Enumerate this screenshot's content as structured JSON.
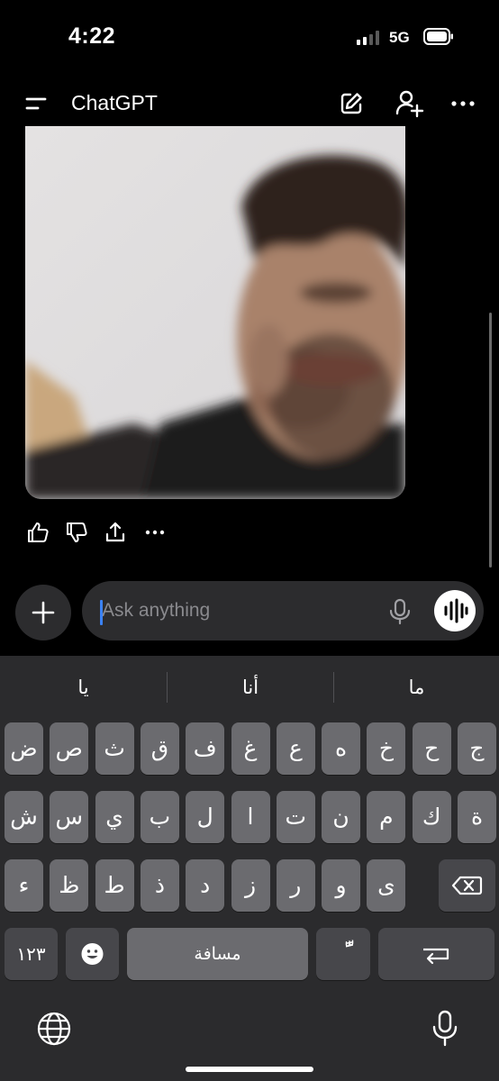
{
  "status_bar": {
    "time": "4:22",
    "network": "5G"
  },
  "header": {
    "title": "ChatGPT"
  },
  "message_actions": [
    "thumbs-up-icon",
    "thumbs-down-icon",
    "share-icon",
    "more-icon"
  ],
  "composer": {
    "placeholder": "Ask anything"
  },
  "keyboard": {
    "suggestions": [
      "يا",
      "أنا",
      "ما"
    ],
    "row1": [
      "ض",
      "ص",
      "ث",
      "ق",
      "ف",
      "غ",
      "ع",
      "ه",
      "خ",
      "ح",
      "ج"
    ],
    "row2": [
      "ش",
      "س",
      "ي",
      "ب",
      "ل",
      "ا",
      "ت",
      "ن",
      "م",
      "ك",
      "ة"
    ],
    "row3": [
      "ء",
      "ظ",
      "ط",
      "ذ",
      "د",
      "ز",
      "ر",
      "و",
      "ى"
    ],
    "numbers_label": "١٢٣",
    "space_label": "مسافة",
    "diacritic_label": "ًّ"
  },
  "colors": {
    "background": "#000000",
    "keyboard": "#2b2b2d",
    "key": "#6b6b6f",
    "caret": "#3b82f6"
  }
}
